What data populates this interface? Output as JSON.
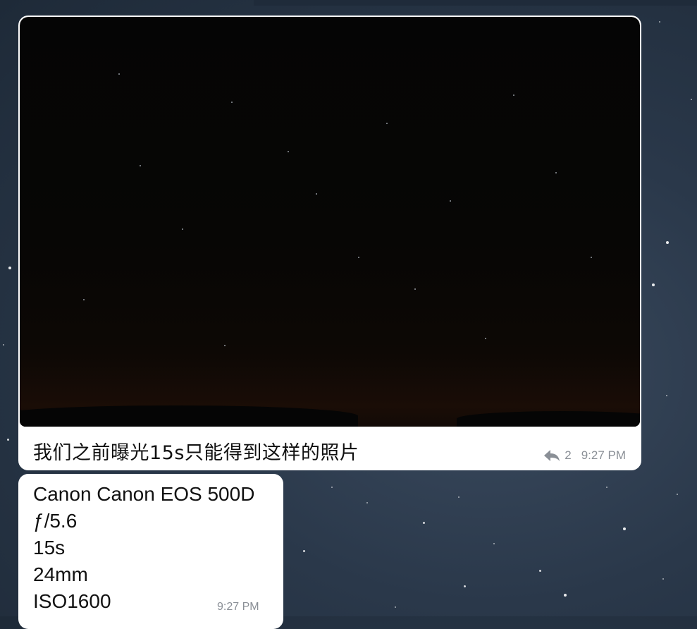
{
  "messages": [
    {
      "type": "photo",
      "caption": "我们之前曝光15s只能得到这样的照片",
      "reply_count": "2",
      "time": "9:27 PM",
      "icons": {
        "reply": "reply-icon"
      }
    },
    {
      "type": "text",
      "lines": [
        "Canon Canon EOS 500D",
        "ƒ/5.6",
        "15s",
        "24mm",
        "ISO1600"
      ],
      "time": "9:27 PM"
    }
  ],
  "colors": {
    "bubble": "#ffffff",
    "meta_text": "#8a8f96",
    "wallpaper": "#2a384a"
  }
}
